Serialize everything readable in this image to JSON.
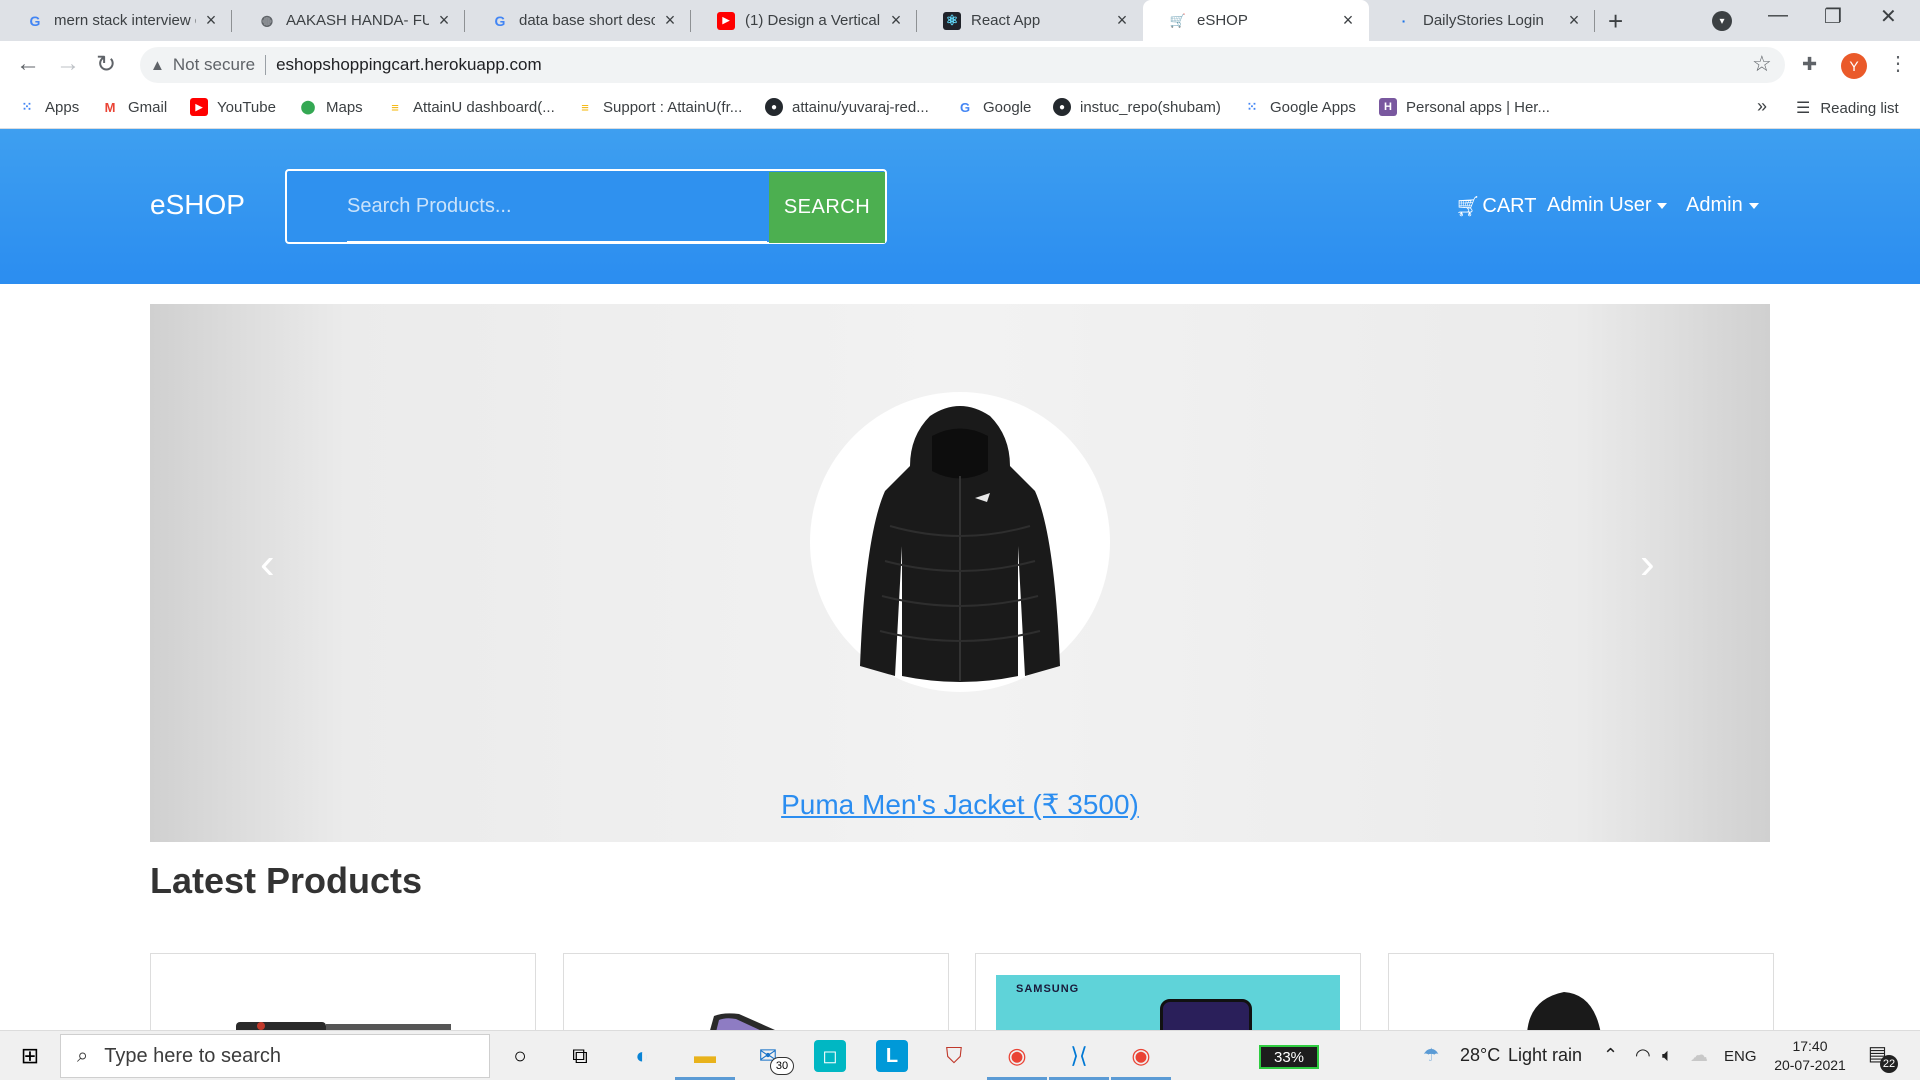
{
  "browser": {
    "tabs": [
      {
        "title": "mern stack interview q",
        "favicon": "G",
        "color": "#4285f4"
      },
      {
        "title": "AAKASH HANDA- FUL",
        "favicon": "◍",
        "color": "#5f6368"
      },
      {
        "title": "data base short descri",
        "favicon": "G",
        "color": "#4285f4"
      },
      {
        "title": "(1) Design a Vertical Ti",
        "favicon": "▶",
        "color": "#ff0000"
      },
      {
        "title": "React App",
        "favicon": "⚛",
        "color": "#61dafb"
      },
      {
        "title": "eSHOP",
        "favicon": "🛒",
        "color": "#5f6368"
      },
      {
        "title": "DailyStories Login",
        "favicon": "·",
        "color": "#1a73e8"
      }
    ],
    "security_label": "Not secure",
    "url": "eshopshoppingcart.herokuapp.com",
    "profile_initial": "Y",
    "bookmarks": [
      {
        "label": "Apps",
        "icon": "apps-grid-icon"
      },
      {
        "label": "Gmail",
        "icon": "gmail-icon"
      },
      {
        "label": "YouTube",
        "icon": "youtube-icon"
      },
      {
        "label": "Maps",
        "icon": "maps-icon"
      },
      {
        "label": "AttainU dashboard(...",
        "icon": "attainu-icon"
      },
      {
        "label": "Support : AttainU(fr...",
        "icon": "attainu-icon"
      },
      {
        "label": "attainu/yuvaraj-red...",
        "icon": "github-icon"
      },
      {
        "label": "Google",
        "icon": "google-icon"
      },
      {
        "label": "instuc_repo(shubam)",
        "icon": "github-icon"
      },
      {
        "label": "Google Apps",
        "icon": "apps-grid-icon"
      },
      {
        "label": "Personal apps | Her...",
        "icon": "heroku-icon"
      }
    ],
    "more_label": "»",
    "reading_list_label": "Reading list"
  },
  "site": {
    "brand": "eSHOP",
    "search_placeholder": "Search Products...",
    "search_button": "SEARCH",
    "cart_label": "CART",
    "user_menu": "Admin User",
    "admin_menu": "Admin",
    "carousel_caption": "Puma Men's Jacket (₹ 3500)",
    "section_title": "Latest Products",
    "card_brand_text": "SAMSUNG"
  },
  "taskbar": {
    "search_placeholder": "Type here to search",
    "mail_badge": "30",
    "battery": "33%",
    "weather_temp": "28°C",
    "weather_text": "Light rain",
    "language": "ENG",
    "time": "17:40",
    "date": "20-07-2021",
    "notification_count": "22"
  },
  "colors": {
    "header_blue": "#2b8df0",
    "search_green": "#4caf50",
    "link_blue": "#2b8df0"
  }
}
